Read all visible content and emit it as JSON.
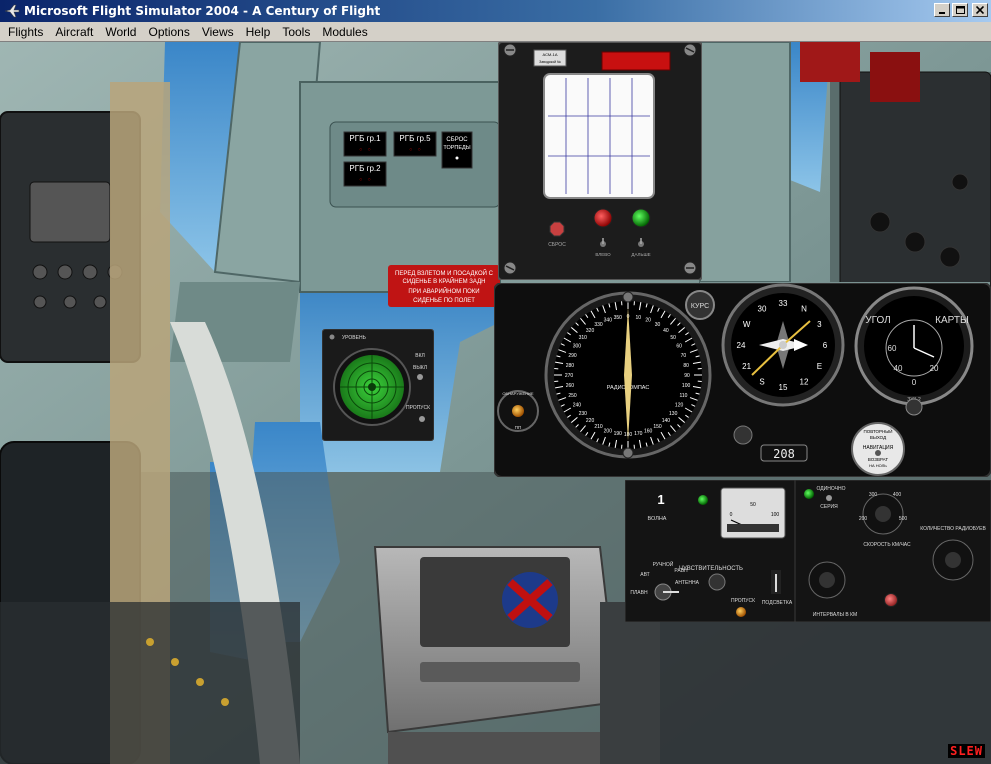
{
  "window": {
    "title": "Microsoft Flight Simulator 2004 - A Century of Flight"
  },
  "menu": {
    "items": [
      {
        "label": "Flights"
      },
      {
        "label": "Aircraft"
      },
      {
        "label": "World"
      },
      {
        "label": "Options"
      },
      {
        "label": "Views"
      },
      {
        "label": "Help"
      },
      {
        "label": "Tools"
      },
      {
        "label": "Modules"
      }
    ]
  },
  "cockpit": {
    "rgb_buttons": {
      "gr1": "РГБ гр.1",
      "gr5": "РГБ гр.5",
      "gr2": "РГБ гр.2",
      "sbros_line1": "СБРОС",
      "sbros_line2": "ТОРПЕДЫ"
    },
    "warning_placard": {
      "line1": "ПЕРЕД ВЗЛЕТОМ И ПОСАДКОЙ С",
      "line2": "СИДЕНЬЕ В КРАЙНЕМ ЗАДН",
      "line3": "ПРИ АВАРИЙНОМ ПОКИ",
      "line4": "СИДЕНЬЕ ПО ПОЛЕТ"
    },
    "recorder": {
      "plate": "АСМ-1А",
      "plate2": "Заводской №",
      "reset_label": "СБРОС",
      "left_label": "ВЛЕВО",
      "right_label": "ДАЛЬШЕ"
    },
    "sonar_scope": {
      "level_label": "УРОВЕНЬ",
      "on_label": "ВКЛ",
      "off_label": "ВЫКЛ",
      "skip_label": "ПРОПУСК"
    },
    "radiocompass": {
      "center_label": "РАДИОКОМПАС",
      "kurs_label": "КУРС",
      "detect_label": "ОБНАРУЖЕНИЕ",
      "pp_label": "ПП",
      "dial_numbers": [
        "0",
        "10",
        "20",
        "30",
        "40",
        "50",
        "60",
        "70",
        "80",
        "90",
        "100",
        "110",
        "120",
        "130",
        "140",
        "150",
        "160",
        "170",
        "180",
        "190",
        "200",
        "210",
        "220",
        "230",
        "240",
        "250",
        "260",
        "270",
        "280",
        "290",
        "300",
        "310",
        "320",
        "330",
        "340",
        "350"
      ]
    },
    "compass": {
      "counter": "208",
      "card_numbers": [
        "33",
        "N",
        "3",
        "6",
        "E",
        "12",
        "15",
        "S",
        "21",
        "24",
        "W",
        "30"
      ]
    },
    "map_angle": {
      "title_left": "УГОЛ",
      "title_right": "КАРТЫ",
      "model": "ЗУК-2",
      "dial": [
        "60",
        "40",
        "20",
        "0"
      ]
    },
    "nav_switch": {
      "line1": "ПОВТОРНЫЙ",
      "line2": "ВЫХОД",
      "line3": "НАВИГАЦИЯ",
      "line4": "ВОЗВРАТ",
      "line5": "НА НОЛЬ"
    },
    "sonar_control": {
      "wave_number": "1",
      "wave_label": "ВОЛНА",
      "sensitivity_label": "ЧУВСТВИТЕЛЬНОСТЬ",
      "plavn_label": "ПЛАВН",
      "avt_label": "АВТ",
      "ruchnoi_label": "РУЧНОЙ",
      "ravn_label": "РАВН",
      "anten_label": "АНТЕННА",
      "skip_label": "ПРОПУСК",
      "podsvetka_label": "ПОДСВЕТКА",
      "meter_ticks": [
        "0",
        "50",
        "100"
      ]
    },
    "drop_control": {
      "single_label": "ОДИНОЧНО",
      "series_label": "СЕРИЯ",
      "qty_label": "КОЛИЧЕСТВО РАДИОБУЕВ",
      "speed_label": "СКОРОСТЬ КМ/ЧАС",
      "interval_label": "ИНТЕРВАЛЫ В КМ",
      "speed_ticks": [
        "300",
        "400",
        "200",
        "500"
      ]
    },
    "slew": "SLEW"
  },
  "colors": {
    "title_start": "#0a246a",
    "title_end": "#a6caf0",
    "menu_bg": "#d4d0c8",
    "slew_red": "#ff2020",
    "sonar_green": "#2ea82e",
    "needle_yellow": "#e8d080",
    "panel_dark": "#1a1a1a"
  }
}
